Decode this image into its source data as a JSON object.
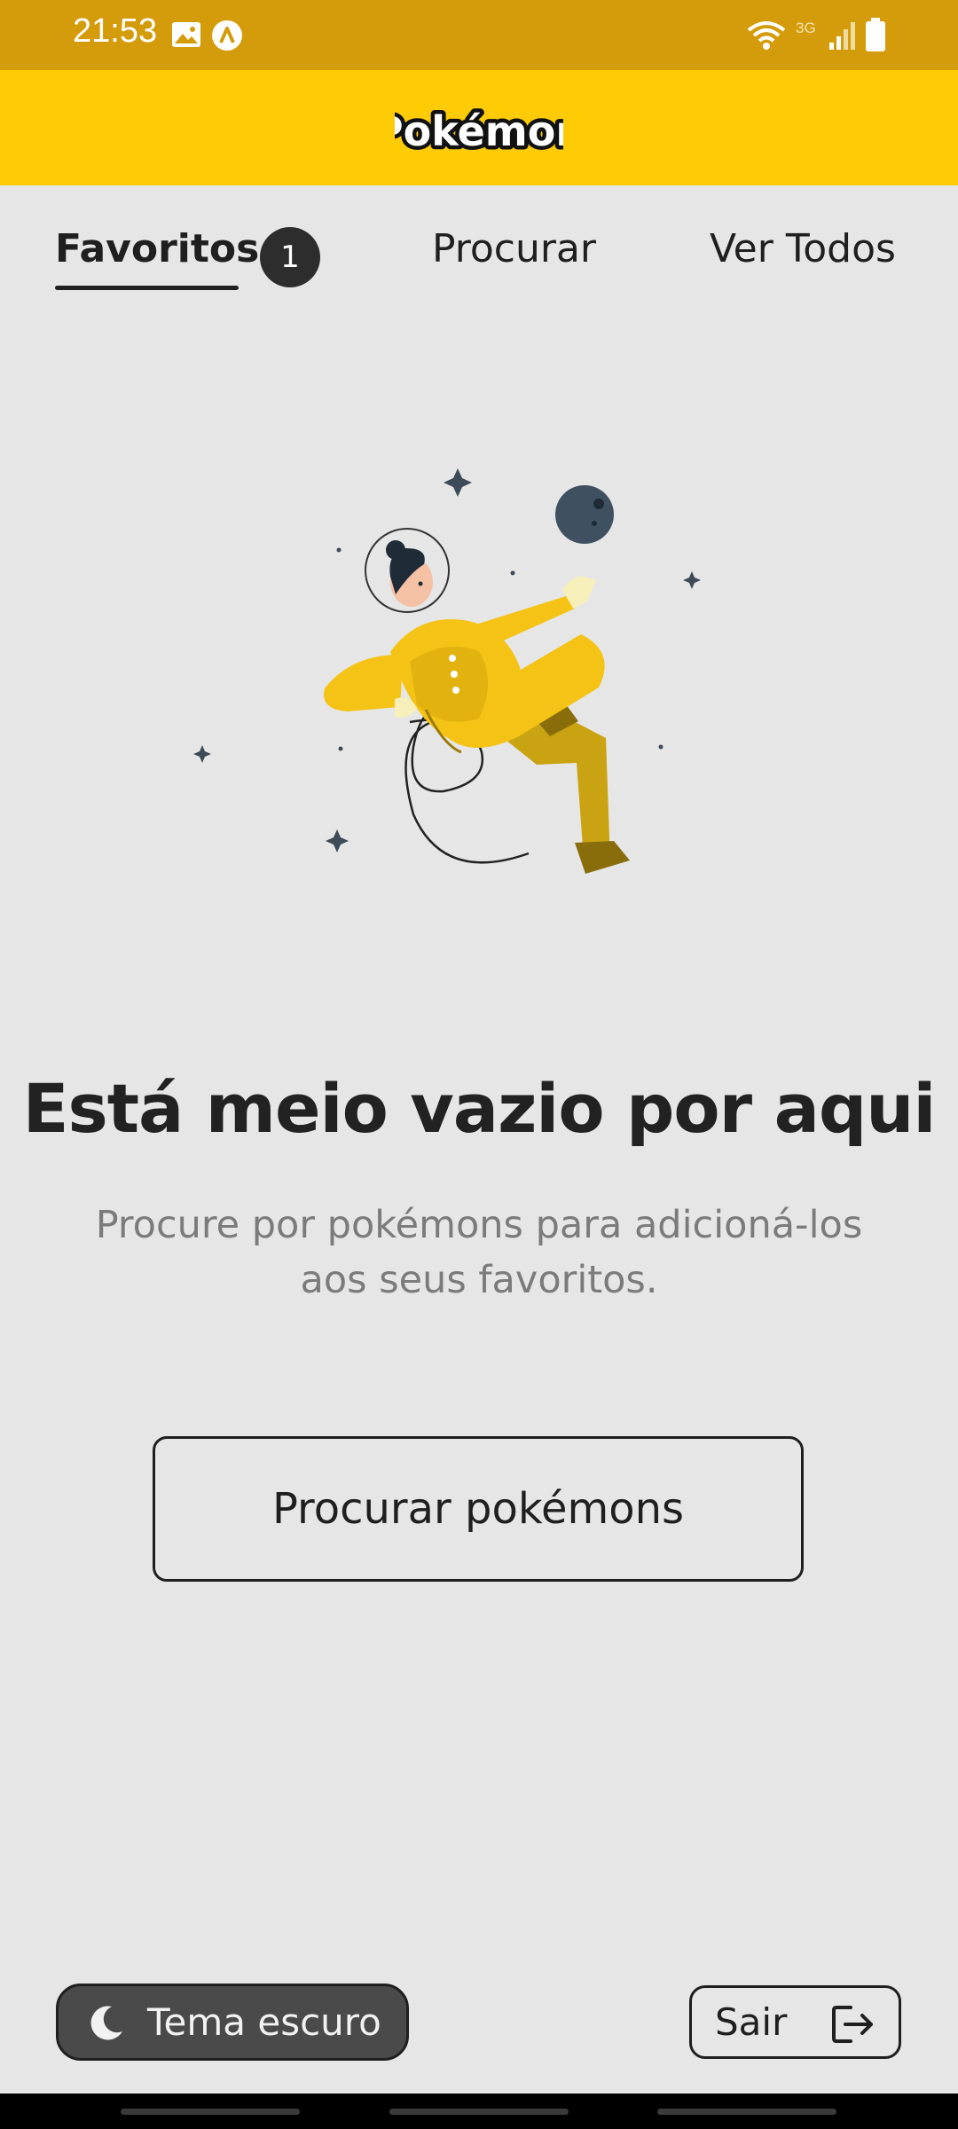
{
  "status_bar": {
    "time": "21:53",
    "network": "3G",
    "icons": [
      "image-icon",
      "app-notification-icon",
      "wifi-icon",
      "signal-icon",
      "battery-icon"
    ]
  },
  "header": {
    "logo_text": "Pokémon",
    "background": "#ffcb05"
  },
  "tabs": [
    {
      "label": "Favoritos",
      "active": true,
      "badge": "1"
    },
    {
      "label": "Procurar",
      "active": false
    },
    {
      "label": "Ver Todos",
      "active": false
    }
  ],
  "empty_state": {
    "illustration": "astronaut-illustration",
    "title": "Está meio vazio por aqui",
    "subtitle_line1": "Procure por pokémons para adicioná-los",
    "subtitle_line2": "aos seus favoritos.",
    "button_label": "Procurar pokémons"
  },
  "footer": {
    "theme_button": "Tema escuro",
    "logout_button": "Sair"
  },
  "colors": {
    "status_bar": "#d49c0b",
    "accent": "#ffcb05",
    "background": "#e6e6e6",
    "text": "#1f1f1f"
  }
}
